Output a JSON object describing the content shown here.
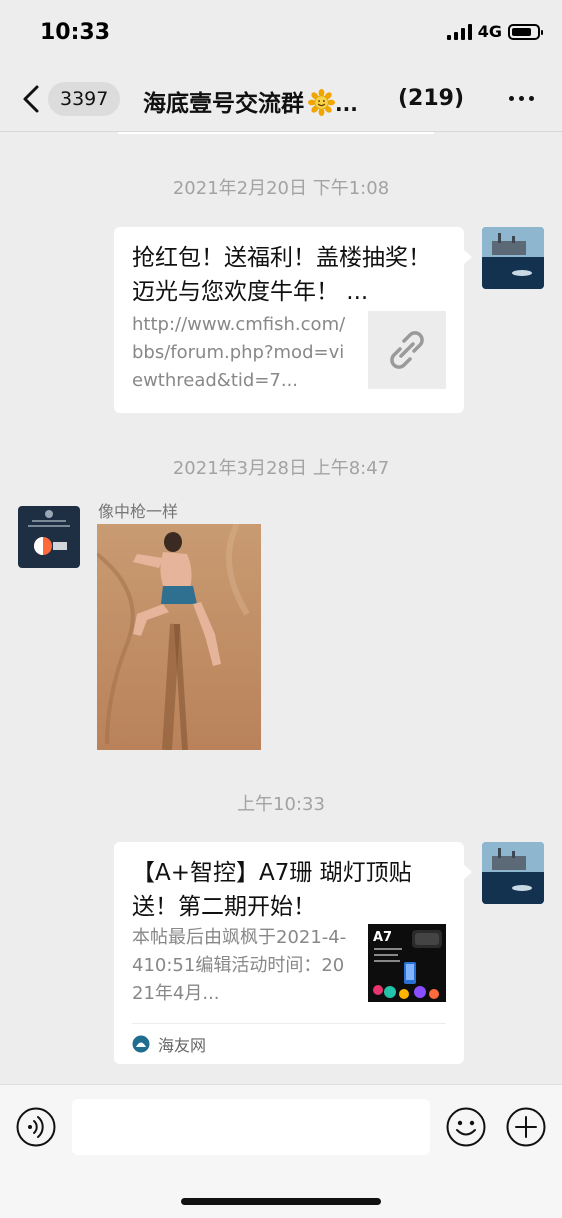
{
  "status_bar": {
    "time": "10:33",
    "network": "4G",
    "battery_level": 0.78
  },
  "nav": {
    "unread_count": "3397",
    "title": "海底壹号交流群",
    "title_emoji_icon": "sunflower-emoji-icon",
    "title_ellipsis": "...",
    "member_count": "(219)"
  },
  "messages": [
    {
      "timestamp": "2021年2月20日 下午1:08",
      "direction": "outgoing",
      "type": "link",
      "title": "抢红包！送福利！盖楼抽奖！迈光与您欢度牛年！ ...",
      "description": "http://www.cmfish.com/bbs/forum.php?mod=viewthread&tid=7...",
      "thumbnail_icon": "link-icon"
    },
    {
      "timestamp": "2021年3月28日 上午8:47",
      "direction": "incoming",
      "type": "image",
      "sender": "像中枪一样",
      "avatar_text": "像中枪一样"
    },
    {
      "timestamp": "上午10:33",
      "direction": "outgoing",
      "type": "link",
      "title": "【A+智控】A7珊 瑚灯顶贴送！第二期开始！",
      "description": "本帖最后由飒枫于2021-4-410:51编辑活动时间：2021年4月...",
      "thumbnail_label": "A7",
      "source": "海友网"
    }
  ],
  "input": {
    "placeholder": ""
  },
  "colors": {
    "background": "#ededed",
    "bubble": "#ffffff",
    "timestamp_text": "#a3a3a3",
    "link_desc_text": "#888888"
  }
}
